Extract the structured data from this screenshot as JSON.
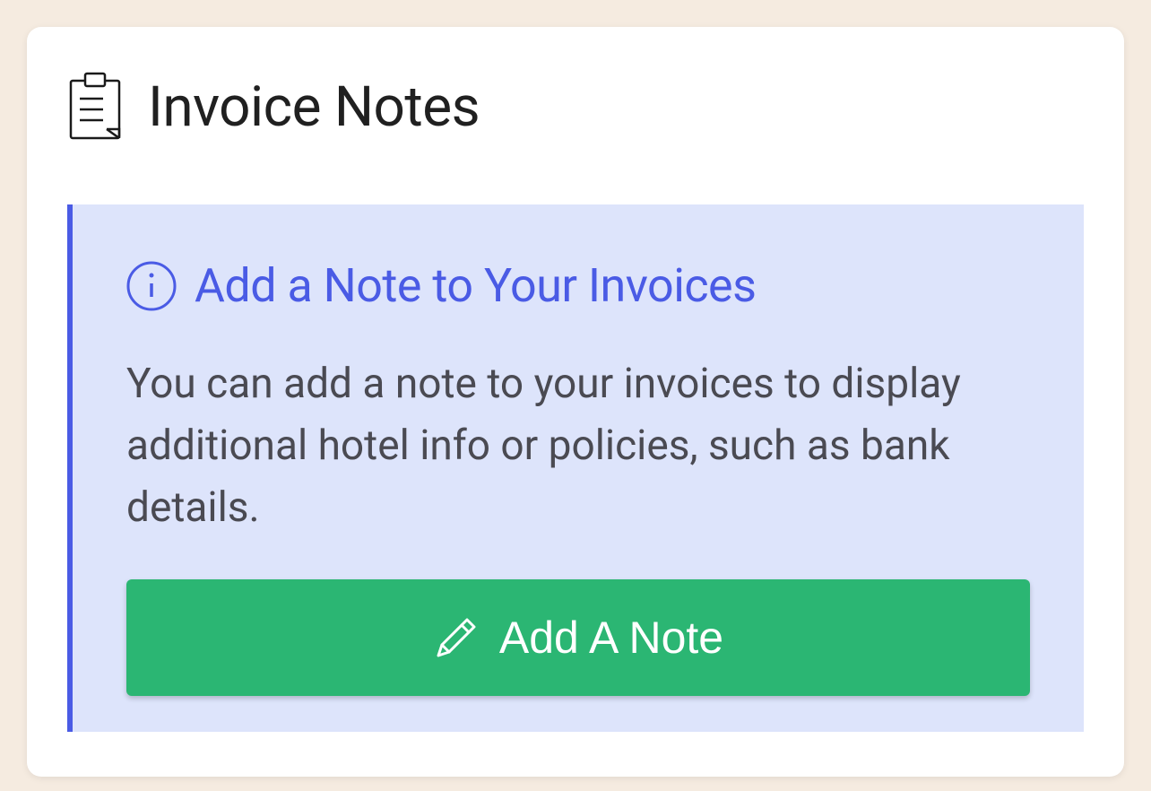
{
  "card": {
    "title": "Invoice Notes"
  },
  "banner": {
    "title": "Add a Note to Your Invoices",
    "description": "You can add a note to your invoices to display additional hotel info or policies, such as bank details."
  },
  "button": {
    "label": "Add A Note"
  }
}
